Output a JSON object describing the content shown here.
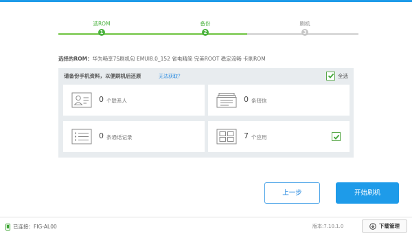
{
  "stepper": {
    "steps": [
      {
        "label": "选ROM",
        "num": "1",
        "state": "done"
      },
      {
        "label": "备份",
        "num": "2",
        "state": "done"
      },
      {
        "label": "刷机",
        "num": "3",
        "state": "todo"
      }
    ]
  },
  "rom": {
    "prefix": "选择的ROM：",
    "name": "华为畅享7S刷机包 EMUI8.0_152 省电精简 完美ROOT 稳定流畅 卡刷ROM"
  },
  "backup": {
    "title": "请备份手机资料，以便刷机后还原",
    "help_link": "无法获取？",
    "select_all_label": "全选",
    "select_all_checked": true,
    "items": [
      {
        "icon": "contacts-icon",
        "count": "0",
        "label": "个联系人",
        "checked": false
      },
      {
        "icon": "sms-icon",
        "count": "0",
        "label": "条短信",
        "checked": false
      },
      {
        "icon": "call-log-icon",
        "count": "0",
        "label": "条通话记录",
        "checked": false
      },
      {
        "icon": "apps-icon",
        "count": "7",
        "label": "个应用",
        "checked": true
      }
    ]
  },
  "buttons": {
    "prev": "上一步",
    "next": "开始刷机"
  },
  "footer": {
    "connection": "已连接：FIG-AL00",
    "version": "版本:7.10.1.0",
    "download_manager": "下载管理"
  },
  "colors": {
    "accent_blue": "#1e9be9",
    "progress_green": "#49b23d",
    "panel_bg": "#e8ecef"
  }
}
